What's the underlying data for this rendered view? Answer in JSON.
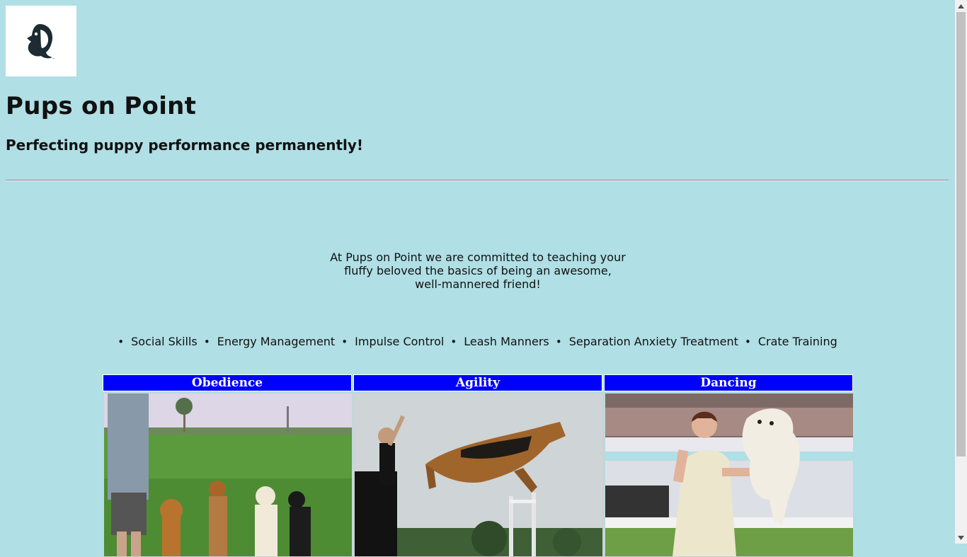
{
  "header": {
    "logo_icon": "dog-head-icon",
    "title": "Pups on Point",
    "tagline": "Perfecting puppy performance permanently!"
  },
  "intro": {
    "line1": "At Pups on Point we are committed to teaching your",
    "line2": "fluffy beloved the basics of being an awesome,",
    "line3": "well-mannered friend!"
  },
  "skills": [
    "Social Skills",
    "Energy Management",
    "Impulse Control",
    "Leash Manners",
    "Separation Anxiety Treatment",
    "Crate Training"
  ],
  "programs": [
    {
      "title": "Obedience",
      "image": "dogs-sitting-on-grass-photo"
    },
    {
      "title": "Agility",
      "image": "german-shepherd-jumping-photo"
    },
    {
      "title": "Dancing",
      "image": "woman-dancing-with-dog-photo"
    }
  ],
  "colors": {
    "background": "#b0dfe5",
    "header_bar": "#0000ff"
  }
}
